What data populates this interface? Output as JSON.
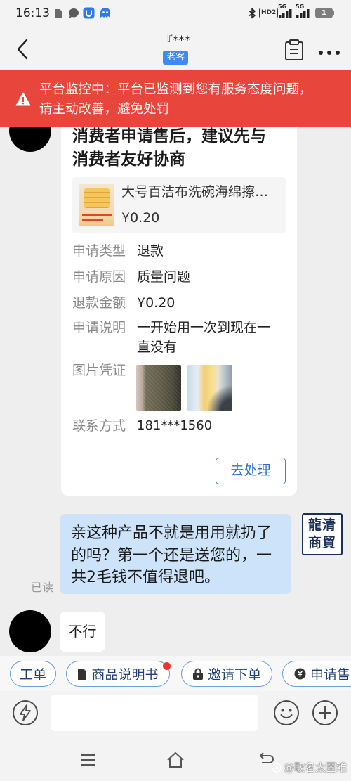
{
  "status_bar": {
    "time": "16:13",
    "hd_label": "HD2",
    "sim1_network": "5G",
    "sim2_network": "5G",
    "battery_level": "1"
  },
  "header": {
    "title": "『***",
    "customer_badge": "老客",
    "icons": [
      "back-chevron-icon",
      "clipboard-icon",
      "more-icon"
    ]
  },
  "alert_banner": {
    "icon": "warning-icon",
    "text": "平台监控中：平台已监测到您有服务态度问题，请主动改善，避免处罚"
  },
  "aftersale_card": {
    "title": "消费者申请售后，建议先与消费者友好协商",
    "product": {
      "name": "大号百洁布洗碗海绵擦…",
      "price": "¥0.20"
    },
    "fields": [
      {
        "label": "申请类型",
        "value": "退款"
      },
      {
        "label": "申请原因",
        "value": "质量问题"
      },
      {
        "label": "退款金额",
        "value": "¥0.20"
      },
      {
        "label": "申请说明",
        "value": "一开始用一次到现在一直没有"
      }
    ],
    "evidence_label": "图片凭证",
    "contact": {
      "label": "联系方式",
      "value": "181***1560"
    },
    "action_label": "去处理"
  },
  "seller_message": {
    "text": "亲这种产品不就是用用就扔了的吗？第一个还是送您的，一共2毛钱不值得退吧。",
    "read_status": "已读",
    "avatar_logo": {
      "line1": "龍清",
      "line2": "商貿"
    }
  },
  "buyer_message": {
    "text": "不行"
  },
  "quick_actions": [
    {
      "label": "工单"
    },
    {
      "label": "商品说明书",
      "icon": "document-icon",
      "has_unread_dot": true
    },
    {
      "label": "邀请下单",
      "icon": "lock-bag-icon"
    },
    {
      "label": "申请售",
      "icon": "yen-icon"
    }
  ],
  "composer": {
    "icons": [
      "lightning-icon",
      "emoji-icon",
      "plus-icon"
    ]
  },
  "system_nav": {
    "icons": [
      "menu-icon",
      "home-icon",
      "back-icon"
    ]
  },
  "watermark": "@取名太困难",
  "colors": {
    "alert_red": "#e8453c",
    "accent_blue": "#2a6fd9",
    "badge_blue": "#3d8af7",
    "seller_bubble": "#cde3f9",
    "pill_border": "#6b9be3",
    "unread_dot": "#f0312f"
  }
}
